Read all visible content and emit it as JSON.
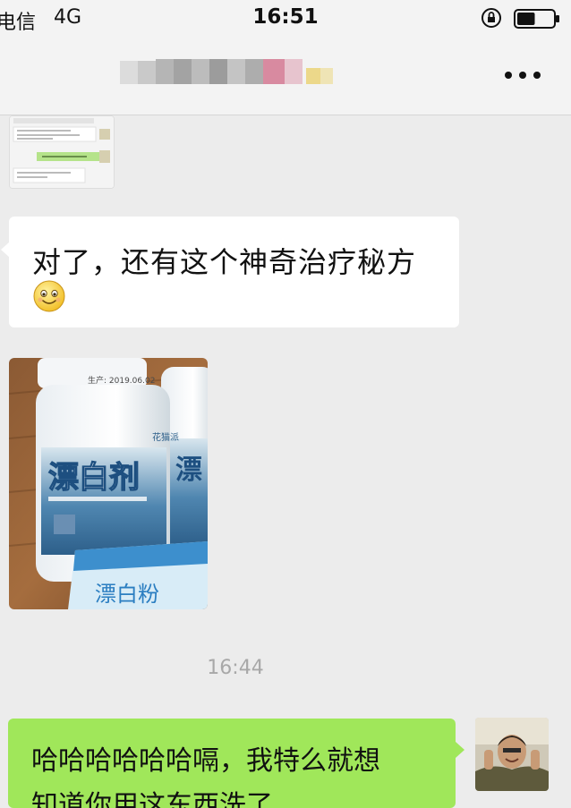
{
  "status_bar": {
    "carrier": "电信",
    "network": "4G",
    "time": "16:51",
    "icons": [
      "orientation-lock-icon",
      "battery-icon"
    ],
    "battery_level": 0.5
  },
  "nav_bar": {
    "title_obscured": true,
    "more_icon": "more-dots-icon"
  },
  "messages": {
    "thumb": {
      "kind": "screenshot-thumbnail"
    },
    "text_message": {
      "text": "对了，还有这个神奇治疗秘方",
      "emoji": "smile-icon"
    },
    "photo_message": {
      "bottle_date": "生产: 2019.06.02",
      "bottle_label": "漂白剂",
      "bottle_brand": "花猫派",
      "sachet_label": "漂白粉"
    },
    "timestamp": "16:44",
    "outgoing": {
      "line1": "哈哈哈哈哈哈嗝，我特么就想",
      "line2": "知道你用这东西洗了"
    }
  },
  "colors": {
    "background": "#ececec",
    "bubble_incoming": "#ffffff",
    "bubble_outgoing": "#a0e75a",
    "timestamp": "#a8a8a8"
  }
}
